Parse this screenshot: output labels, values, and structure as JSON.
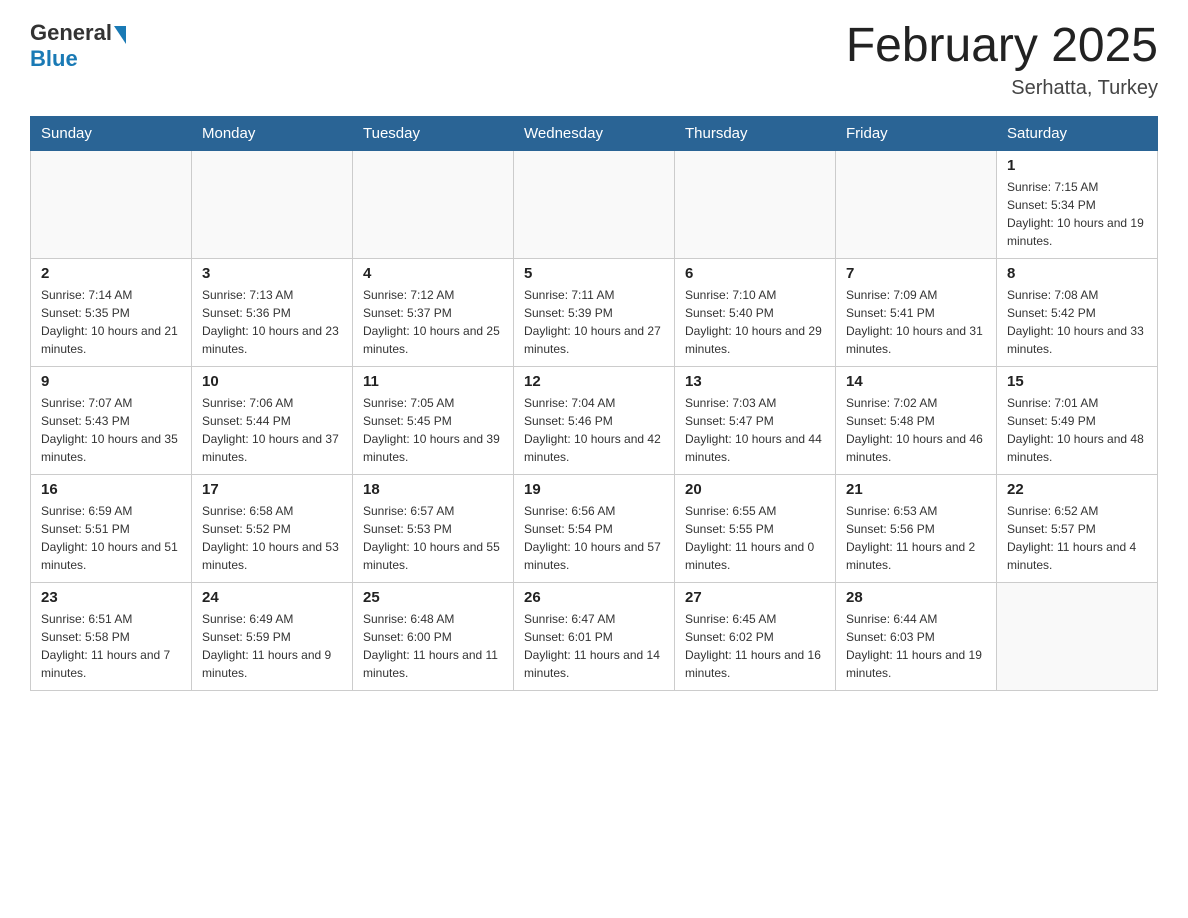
{
  "header": {
    "logo_general": "General",
    "logo_blue": "Blue",
    "month_title": "February 2025",
    "location": "Serhatta, Turkey"
  },
  "days_of_week": [
    "Sunday",
    "Monday",
    "Tuesday",
    "Wednesday",
    "Thursday",
    "Friday",
    "Saturday"
  ],
  "weeks": [
    {
      "days": [
        {
          "num": "",
          "info": ""
        },
        {
          "num": "",
          "info": ""
        },
        {
          "num": "",
          "info": ""
        },
        {
          "num": "",
          "info": ""
        },
        {
          "num": "",
          "info": ""
        },
        {
          "num": "",
          "info": ""
        },
        {
          "num": "1",
          "info": "Sunrise: 7:15 AM\nSunset: 5:34 PM\nDaylight: 10 hours and 19 minutes."
        }
      ]
    },
    {
      "days": [
        {
          "num": "2",
          "info": "Sunrise: 7:14 AM\nSunset: 5:35 PM\nDaylight: 10 hours and 21 minutes."
        },
        {
          "num": "3",
          "info": "Sunrise: 7:13 AM\nSunset: 5:36 PM\nDaylight: 10 hours and 23 minutes."
        },
        {
          "num": "4",
          "info": "Sunrise: 7:12 AM\nSunset: 5:37 PM\nDaylight: 10 hours and 25 minutes."
        },
        {
          "num": "5",
          "info": "Sunrise: 7:11 AM\nSunset: 5:39 PM\nDaylight: 10 hours and 27 minutes."
        },
        {
          "num": "6",
          "info": "Sunrise: 7:10 AM\nSunset: 5:40 PM\nDaylight: 10 hours and 29 minutes."
        },
        {
          "num": "7",
          "info": "Sunrise: 7:09 AM\nSunset: 5:41 PM\nDaylight: 10 hours and 31 minutes."
        },
        {
          "num": "8",
          "info": "Sunrise: 7:08 AM\nSunset: 5:42 PM\nDaylight: 10 hours and 33 minutes."
        }
      ]
    },
    {
      "days": [
        {
          "num": "9",
          "info": "Sunrise: 7:07 AM\nSunset: 5:43 PM\nDaylight: 10 hours and 35 minutes."
        },
        {
          "num": "10",
          "info": "Sunrise: 7:06 AM\nSunset: 5:44 PM\nDaylight: 10 hours and 37 minutes."
        },
        {
          "num": "11",
          "info": "Sunrise: 7:05 AM\nSunset: 5:45 PM\nDaylight: 10 hours and 39 minutes."
        },
        {
          "num": "12",
          "info": "Sunrise: 7:04 AM\nSunset: 5:46 PM\nDaylight: 10 hours and 42 minutes."
        },
        {
          "num": "13",
          "info": "Sunrise: 7:03 AM\nSunset: 5:47 PM\nDaylight: 10 hours and 44 minutes."
        },
        {
          "num": "14",
          "info": "Sunrise: 7:02 AM\nSunset: 5:48 PM\nDaylight: 10 hours and 46 minutes."
        },
        {
          "num": "15",
          "info": "Sunrise: 7:01 AM\nSunset: 5:49 PM\nDaylight: 10 hours and 48 minutes."
        }
      ]
    },
    {
      "days": [
        {
          "num": "16",
          "info": "Sunrise: 6:59 AM\nSunset: 5:51 PM\nDaylight: 10 hours and 51 minutes."
        },
        {
          "num": "17",
          "info": "Sunrise: 6:58 AM\nSunset: 5:52 PM\nDaylight: 10 hours and 53 minutes."
        },
        {
          "num": "18",
          "info": "Sunrise: 6:57 AM\nSunset: 5:53 PM\nDaylight: 10 hours and 55 minutes."
        },
        {
          "num": "19",
          "info": "Sunrise: 6:56 AM\nSunset: 5:54 PM\nDaylight: 10 hours and 57 minutes."
        },
        {
          "num": "20",
          "info": "Sunrise: 6:55 AM\nSunset: 5:55 PM\nDaylight: 11 hours and 0 minutes."
        },
        {
          "num": "21",
          "info": "Sunrise: 6:53 AM\nSunset: 5:56 PM\nDaylight: 11 hours and 2 minutes."
        },
        {
          "num": "22",
          "info": "Sunrise: 6:52 AM\nSunset: 5:57 PM\nDaylight: 11 hours and 4 minutes."
        }
      ]
    },
    {
      "days": [
        {
          "num": "23",
          "info": "Sunrise: 6:51 AM\nSunset: 5:58 PM\nDaylight: 11 hours and 7 minutes."
        },
        {
          "num": "24",
          "info": "Sunrise: 6:49 AM\nSunset: 5:59 PM\nDaylight: 11 hours and 9 minutes."
        },
        {
          "num": "25",
          "info": "Sunrise: 6:48 AM\nSunset: 6:00 PM\nDaylight: 11 hours and 11 minutes."
        },
        {
          "num": "26",
          "info": "Sunrise: 6:47 AM\nSunset: 6:01 PM\nDaylight: 11 hours and 14 minutes."
        },
        {
          "num": "27",
          "info": "Sunrise: 6:45 AM\nSunset: 6:02 PM\nDaylight: 11 hours and 16 minutes."
        },
        {
          "num": "28",
          "info": "Sunrise: 6:44 AM\nSunset: 6:03 PM\nDaylight: 11 hours and 19 minutes."
        },
        {
          "num": "",
          "info": ""
        }
      ]
    }
  ]
}
